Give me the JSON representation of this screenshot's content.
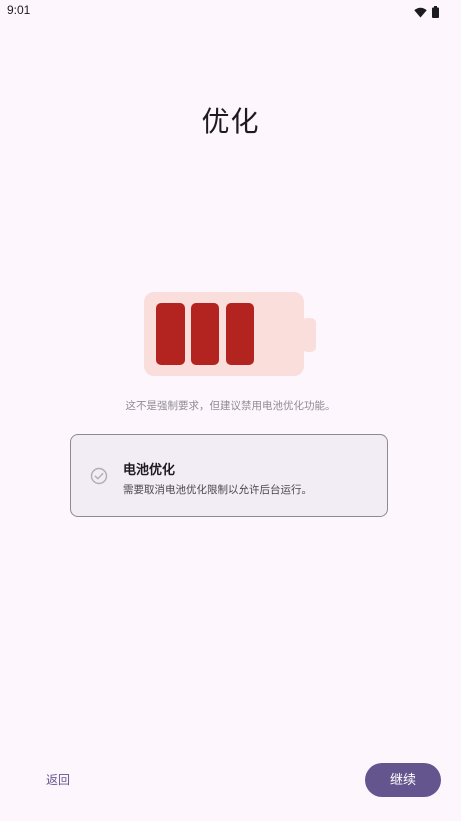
{
  "status_bar": {
    "time": "9:01",
    "icons": [
      "wifi-icon",
      "battery-icon"
    ]
  },
  "page": {
    "title": "优化",
    "illustration": "battery-icon",
    "hint": "这不是强制要求，但建议禁用电池优化功能。"
  },
  "card": {
    "icon": "check-circle-icon",
    "title": "电池优化",
    "description": "需要取消电池优化限制以允许后台运行。"
  },
  "footer": {
    "back_label": "返回",
    "continue_label": "继续"
  },
  "colors": {
    "background": "#fdf7fd",
    "accent": "#65558f",
    "battery_fill": "#b3231f",
    "battery_body": "#f9dedc"
  }
}
